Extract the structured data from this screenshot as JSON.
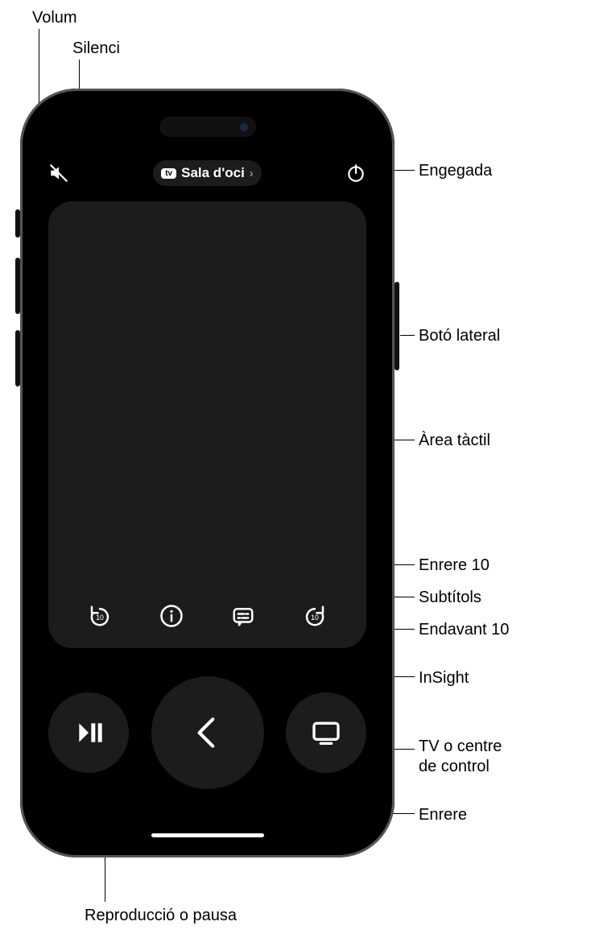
{
  "callouts": {
    "volum": "Volum",
    "silenci": "Silenci",
    "engegada": "Engegada",
    "boto_lateral": "Botó lateral",
    "area_tactil": "Àrea tàctil",
    "enrere_10": "Enrere 10",
    "subtitols": "Subtítols",
    "endavant_10": "Endavant 10",
    "insight": "InSight",
    "tv_centre": "TV o centre\nde control",
    "enrere": "Enrere",
    "repro_pausa": "Reproducció o pausa"
  },
  "top": {
    "tv_brand": "tv",
    "device_name": "Sala d'oci"
  }
}
